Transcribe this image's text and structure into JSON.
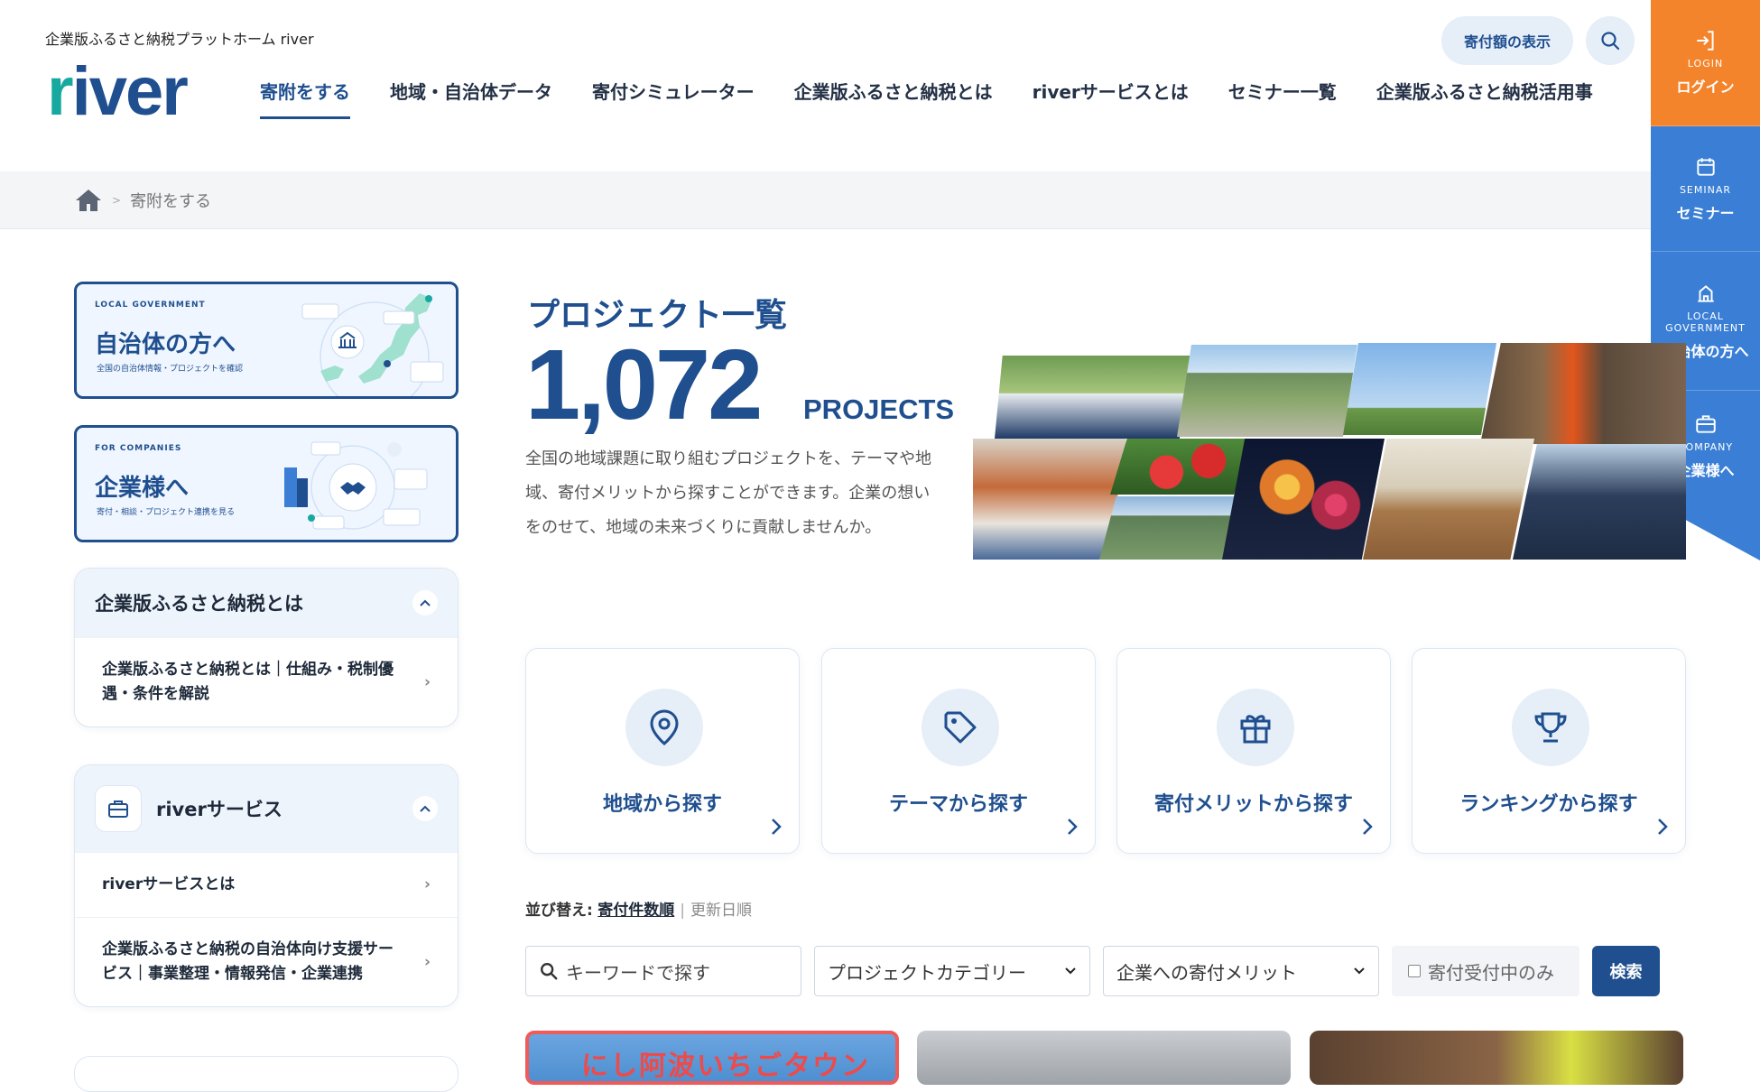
{
  "header": {
    "tagline": "企業版ふるさと納税プラットホーム river",
    "logo_text": "river",
    "nav": [
      "寄附をする",
      "地域・自治体データ",
      "寄付シミュレーター",
      "企業版ふるさと納税とは",
      "riverサービスとは",
      "セミナー一覧",
      "企業版ふるさと納税活用事"
    ],
    "amount_button": "寄付額の表示"
  },
  "side_menu": [
    {
      "en": "LOGIN",
      "ja": "ログイン"
    },
    {
      "en": "SEMINAR",
      "ja": "セミナー"
    },
    {
      "en": "LOCAL GOVERNMENT",
      "ja": "自治体の方へ"
    },
    {
      "en": "COMPANY",
      "ja": "企業様へ"
    }
  ],
  "breadcrumb": {
    "current": "寄附をする",
    "separator": ">"
  },
  "left": {
    "gov_card": {
      "en": "LOCAL GOVERNMENT",
      "ja": "自治体の方へ",
      "sub": "全国の自治体情報・プロジェクトを確認"
    },
    "company_card": {
      "en": "FOR COMPANIES",
      "ja": "企業様へ",
      "sub": "寄付・相談・プロジェクト連携を見る"
    },
    "accordion1": {
      "title": "企業版ふるさと納税とは",
      "items": [
        "企業版ふるさと納税とは｜仕組み・税制優遇・条件を解説"
      ]
    },
    "accordion2": {
      "title": "riverサービス",
      "items": [
        "riverサービスとは",
        "企業版ふるさと納税の自治体向け支援サービス｜事業整理・情報発信・企業連携"
      ]
    }
  },
  "main": {
    "title": "プロジェクト一覧",
    "count": "1,072",
    "count_unit": "PROJECTS",
    "description": "全国の地域課題に取り組むプロジェクトを、テーマや地域、寄付メリットから探すことができます。企業の想いをのせて、地域の未来づくりに貢献しませんか。",
    "tiles": [
      "地域から探す",
      "テーマから探す",
      "寄付メリットから探す",
      "ランキングから探す"
    ],
    "sort": {
      "label": "並び替え:",
      "active": "寄付件数順",
      "alt": "更新日順"
    },
    "search": {
      "placeholder": "キーワードで探す",
      "category": "プロジェクトカテゴリー",
      "merit": "企業への寄付メリット",
      "checkbox": "寄付受付中のみ",
      "button": "検索"
    },
    "bottom_card_text": "にし阿波いちごタウン"
  },
  "colors": {
    "brand": "#1f4f8f",
    "accent_teal": "#17a9a0",
    "orange": "#f4842b",
    "side_blue": "#3a7fd5"
  }
}
